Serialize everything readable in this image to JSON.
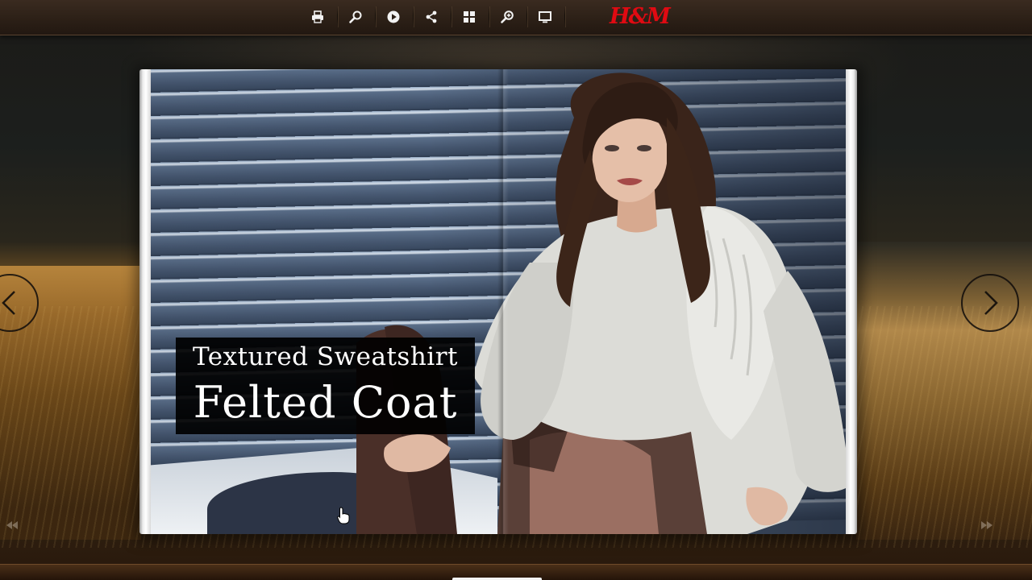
{
  "toolbar": {
    "buttons": [
      {
        "name": "print-button",
        "icon": "printer-icon"
      },
      {
        "name": "search-button",
        "icon": "search-icon"
      },
      {
        "name": "autoplay-button",
        "icon": "play-icon"
      },
      {
        "name": "share-button",
        "icon": "share-icon"
      },
      {
        "name": "thumbnails-button",
        "icon": "grid-icon"
      },
      {
        "name": "zoom-button",
        "icon": "zoom-in-icon"
      },
      {
        "name": "fullscreen-button",
        "icon": "monitor-icon"
      }
    ],
    "logo_text": "H&M",
    "logo_color": "#e00a12"
  },
  "page": {
    "caption_subtitle": "Textured Sweatshirt",
    "caption_title": "Felted Coat"
  },
  "navigation": {
    "prev_icon": "chevron-left-icon",
    "next_icon": "chevron-right-icon",
    "first_page_icon": "double-arrow-left-icon",
    "last_page_icon": "double-arrow-right-icon"
  },
  "colors": {
    "toolbar_bg": "#2b1f16",
    "icon_color": "#f2f2f2",
    "caption_bg": "#000000"
  }
}
